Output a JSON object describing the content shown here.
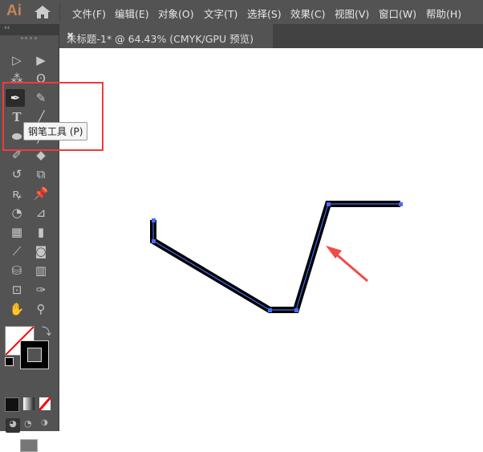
{
  "app": {
    "logo": "Ai"
  },
  "menu": [
    "文件(F)",
    "编辑(E)",
    "对象(O)",
    "文字(T)",
    "选择(S)",
    "效果(C)",
    "视图(V)",
    "窗口(W)",
    "帮助(H)"
  ],
  "tab": {
    "title": "未标题-1* @ 64.43% (CMYK/GPU 预览)",
    "close": "✖"
  },
  "toolbar": {
    "collapse": "‹‹",
    "tooltip": "钢笔工具 (P)",
    "active_tool": "pen-tool"
  },
  "colors": {
    "accent_highlight": "#f23a3a",
    "path_stroke": "#000000",
    "selection": "#4a6cf0",
    "stroke_swatch": "#000000",
    "fill_swatch": "none"
  }
}
